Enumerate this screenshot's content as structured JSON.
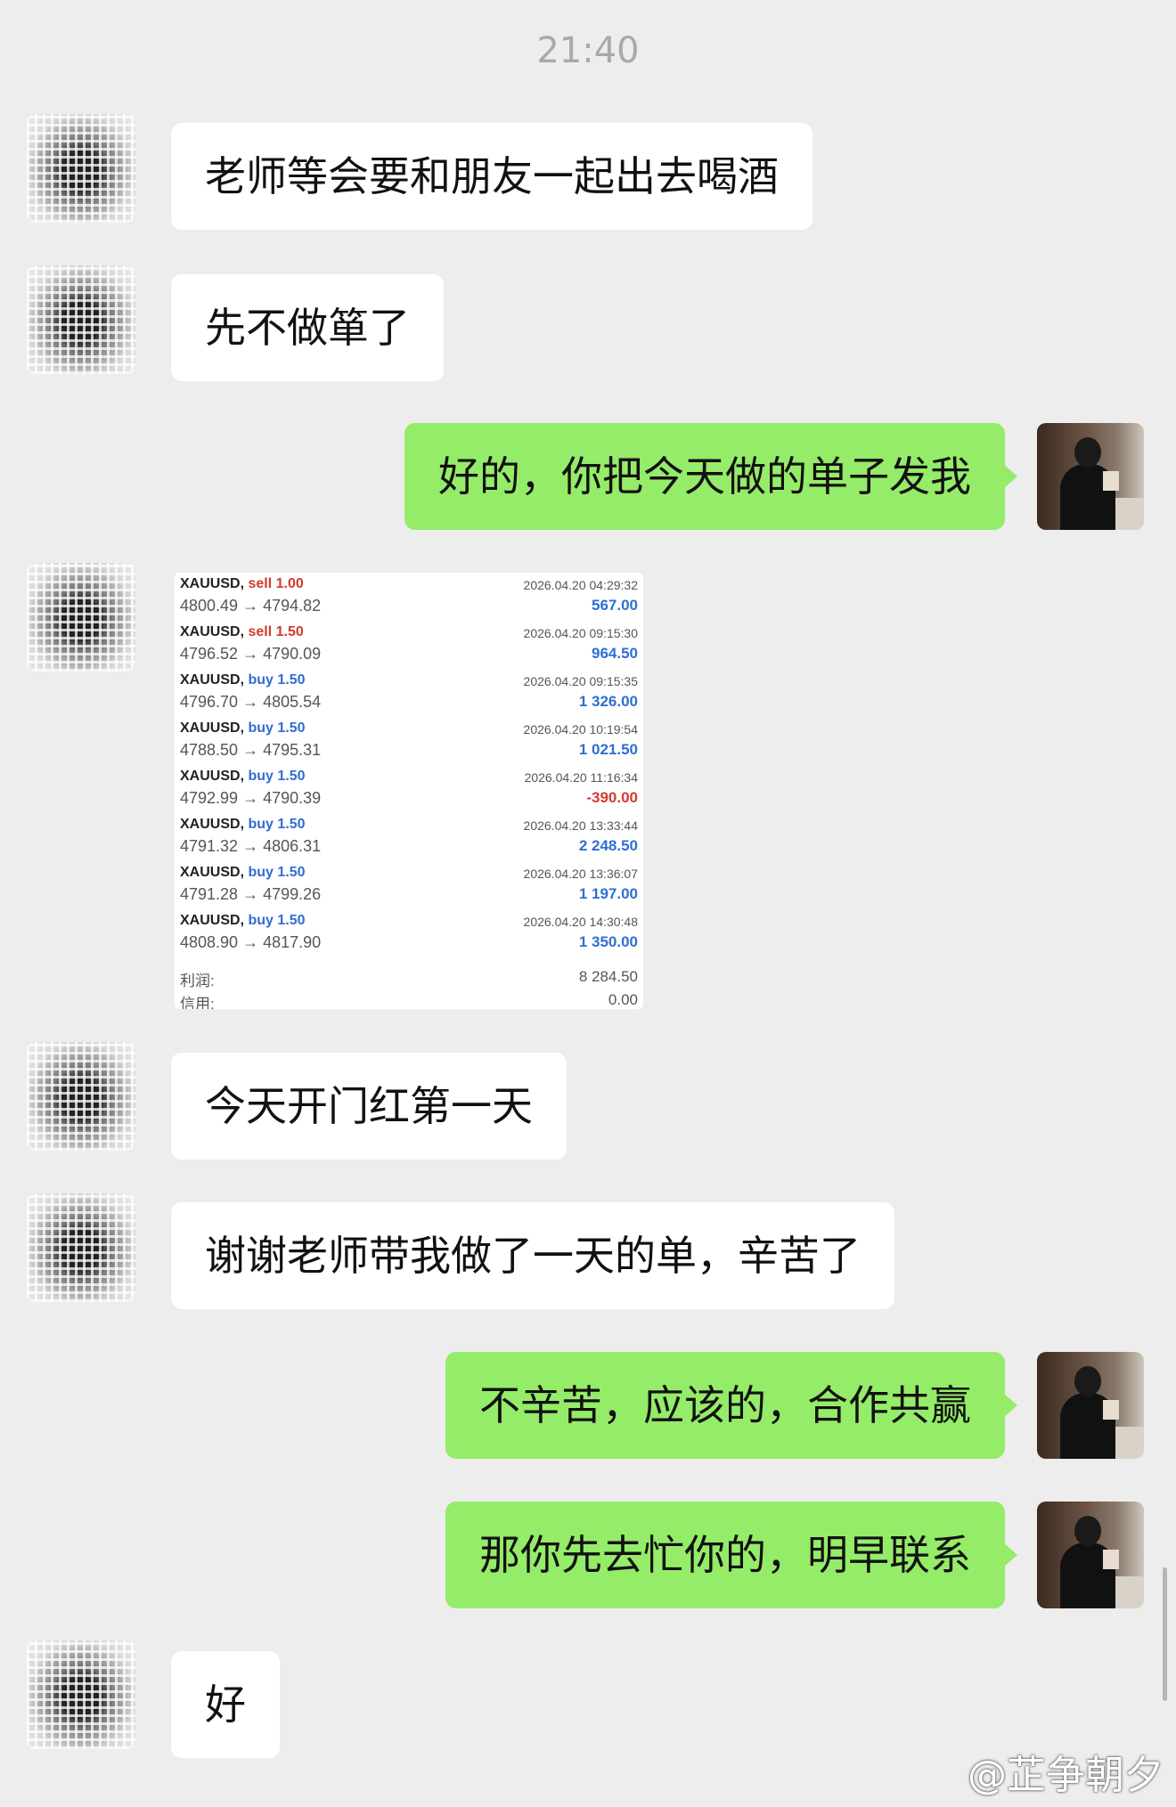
{
  "time": "21:40",
  "messages": [
    {
      "text": "老师等会要和朋友一起出去喝酒"
    },
    {
      "text": "先不做箪了"
    },
    {
      "text": "好的，你把今天做的单子发我"
    },
    {
      "text": "今天开门红第一天"
    },
    {
      "text": "谢谢老师带我做了一天的单，辛苦了"
    },
    {
      "text": "不辛苦，应该的，合作共赢"
    },
    {
      "text": "那你先去忙你的，明早联系"
    },
    {
      "text": "好"
    }
  ],
  "trades": [
    {
      "symbol": "XAUUSD,",
      "dir": "sell",
      "lot": "1.00",
      "prices": "4800.49 → 4794.82",
      "datetime": "2026.04.20 04:29:32",
      "pl": "567.00",
      "sign": "pos"
    },
    {
      "symbol": "XAUUSD,",
      "dir": "sell",
      "lot": "1.50",
      "prices": "4796.52 → 4790.09",
      "datetime": "2026.04.20 09:15:30",
      "pl": "964.50",
      "sign": "pos"
    },
    {
      "symbol": "XAUUSD,",
      "dir": "buy",
      "lot": "1.50",
      "prices": "4796.70 → 4805.54",
      "datetime": "2026.04.20 09:15:35",
      "pl": "1 326.00",
      "sign": "pos"
    },
    {
      "symbol": "XAUUSD,",
      "dir": "buy",
      "lot": "1.50",
      "prices": "4788.50 → 4795.31",
      "datetime": "2026.04.20 10:19:54",
      "pl": "1 021.50",
      "sign": "pos"
    },
    {
      "symbol": "XAUUSD,",
      "dir": "buy",
      "lot": "1.50",
      "prices": "4792.99 → 4790.39",
      "datetime": "2026.04.20 11:16:34",
      "pl": "-390.00",
      "sign": "neg"
    },
    {
      "symbol": "XAUUSD,",
      "dir": "buy",
      "lot": "1.50",
      "prices": "4791.32 → 4806.31",
      "datetime": "2026.04.20 13:33:44",
      "pl": "2 248.50",
      "sign": "pos"
    },
    {
      "symbol": "XAUUSD,",
      "dir": "buy",
      "lot": "1.50",
      "prices": "4791.28 → 4799.26",
      "datetime": "2026.04.20 13:36:07",
      "pl": "1 197.00",
      "sign": "pos"
    },
    {
      "symbol": "XAUUSD,",
      "dir": "buy",
      "lot": "1.50",
      "prices": "4808.90 → 4817.90",
      "datetime": "2026.04.20 14:30:48",
      "pl": "1 350.00",
      "sign": "pos"
    }
  ],
  "summary": [
    {
      "label": "利润:",
      "value": "8 284.50"
    },
    {
      "label": "信用:",
      "value": "0.00"
    }
  ],
  "watermark": "@芷争朝夕"
}
